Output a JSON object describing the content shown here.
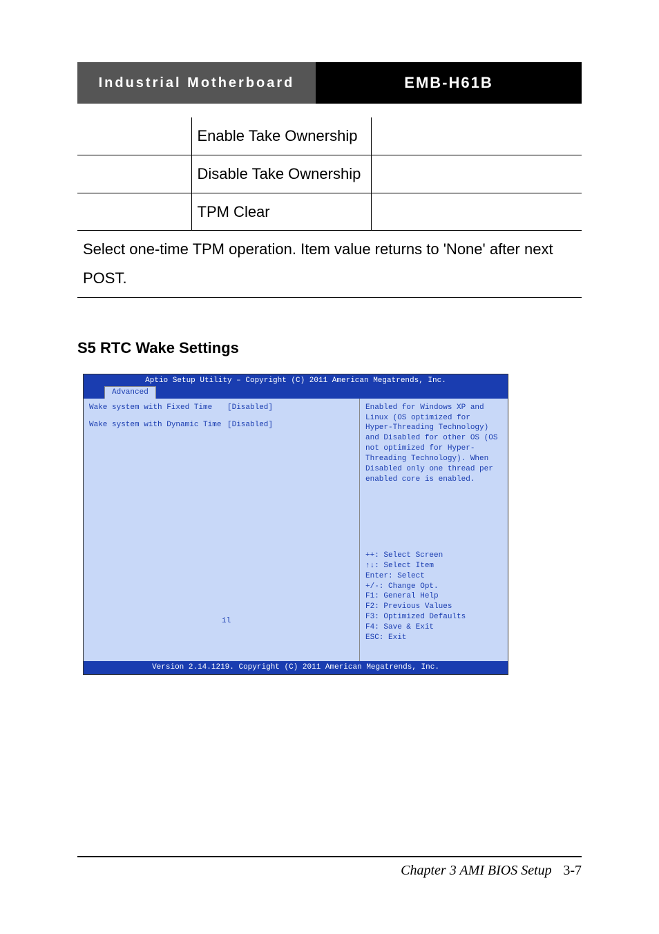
{
  "header": {
    "left": "Industrial Motherboard",
    "right": "EMB-H61B"
  },
  "table": {
    "options": [
      "Enable Take Ownership",
      "Disable Take Ownership",
      "TPM Clear"
    ],
    "note": "Select one-time TPM operation. Item value returns to 'None' after next POST."
  },
  "section_title": "S5 RTC Wake Settings",
  "bios": {
    "top": "Aptio Setup Utility – Copyright (C) 2011 American Megatrends, Inc.",
    "tab": "Advanced",
    "rows": [
      {
        "label": "Wake system with Fixed Time",
        "value": "[Disabled]"
      },
      {
        "label": "Wake system with Dynamic Time",
        "value": "[Disabled]"
      }
    ],
    "stray": "il",
    "help": "Enabled for Windows XP and Linux (OS optimized for Hyper-Threading Technology) and Disabled for other OS (OS not optimized for Hyper-Threading Technology). When Disabled only one thread per enabled core is enabled.",
    "keys": [
      "++: Select Screen",
      "↑↓: Select Item",
      "Enter: Select",
      "+/-: Change Opt.",
      "F1: General Help",
      "F2: Previous Values",
      "F3: Optimized Defaults",
      "F4: Save & Exit",
      "ESC: Exit"
    ],
    "footer": "Version 2.14.1219. Copyright (C) 2011 American Megatrends, Inc."
  },
  "footer": {
    "chapter": "Chapter 3 AMI BIOS Setup",
    "page": "3-7"
  }
}
